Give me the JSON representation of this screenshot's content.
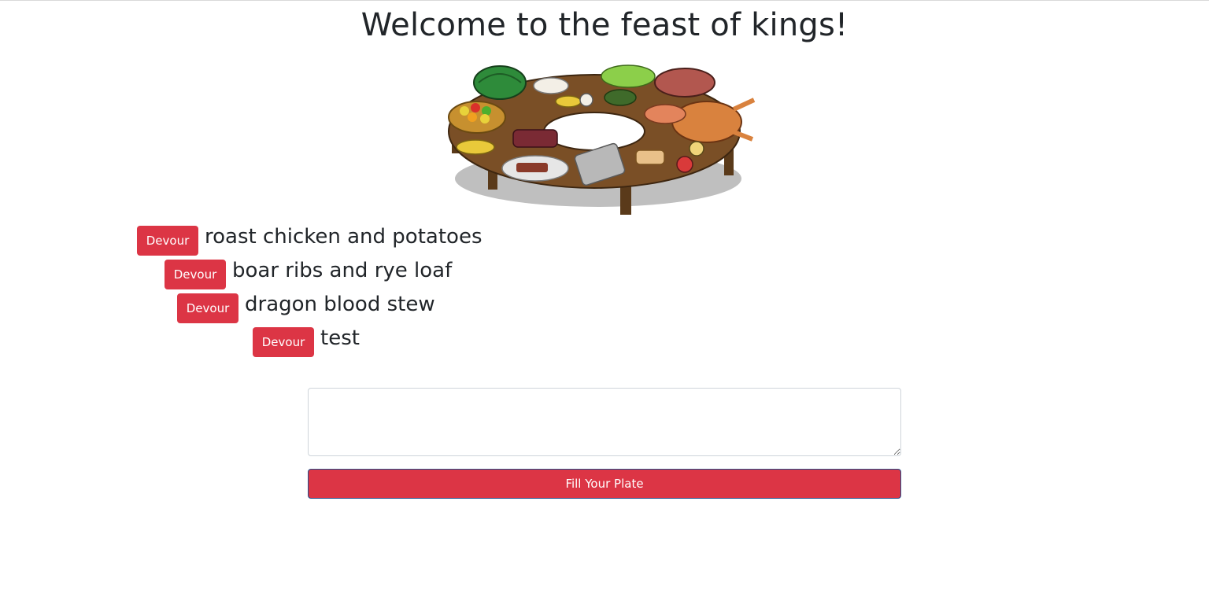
{
  "header": {
    "title": "Welcome to the feast of kings!"
  },
  "hero": {
    "icon": "feast-table-illustration"
  },
  "foods": [
    {
      "button_label": "Devour",
      "name": "roast chicken and potatoes"
    },
    {
      "button_label": "Devour",
      "name": "boar ribs and rye loaf"
    },
    {
      "button_label": "Devour",
      "name": "dragon blood stew"
    },
    {
      "button_label": "Devour",
      "name": "test"
    }
  ],
  "form": {
    "input_value": "",
    "submit_label": "Fill Your Plate"
  },
  "colors": {
    "accent": "#dc3545",
    "text": "#212529"
  }
}
